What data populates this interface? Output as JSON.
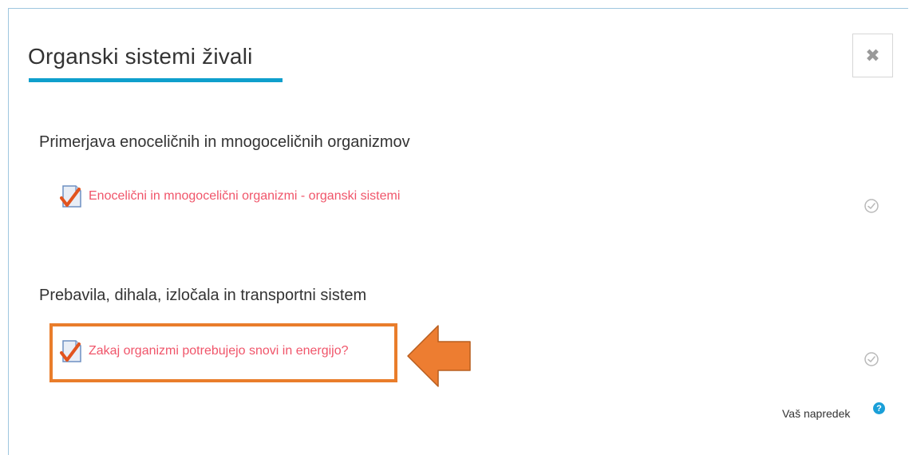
{
  "modal": {
    "title": "Organski sistemi živali",
    "close_icon": "close-icon"
  },
  "sections": [
    {
      "heading": "Primerjava enoceličnih in mnogoceličnih organizmov",
      "activity": {
        "label": "Enocelični in mnogocelični organizmi - organski sistemi",
        "icon": "quiz-icon",
        "completion": "not-complete"
      }
    },
    {
      "heading": "Prebavila, dihala, izločala in transportni sistem",
      "activity": {
        "label": "Zakaj organizmi potrebujejo snovi in energijo?",
        "icon": "quiz-icon",
        "completion": "not-complete"
      }
    }
  ],
  "progress": {
    "label": "Vaš napredek",
    "help_icon": "?"
  },
  "colors": {
    "accent": "#0f9fcc",
    "link": "#f0556a",
    "highlight": "#e97d2b",
    "help": "#1a9fd8"
  }
}
